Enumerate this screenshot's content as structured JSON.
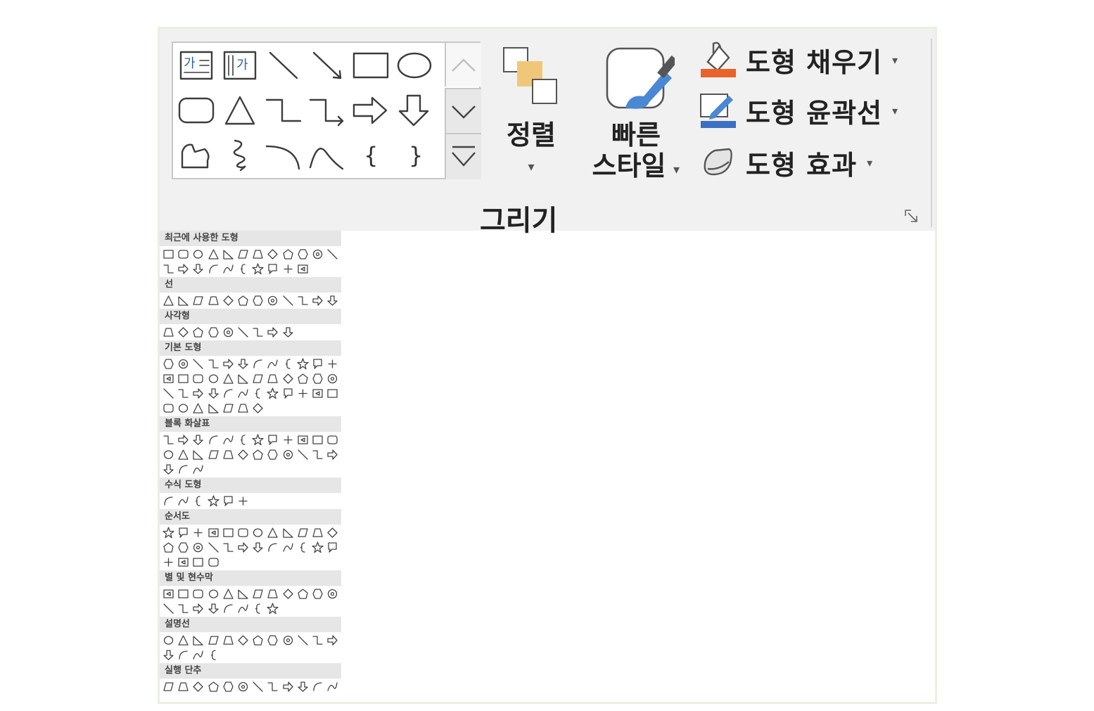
{
  "ribbon": {
    "group_label": "그리기",
    "gallery_shapes": [
      {
        "icon": "horizontal-text-box-icon",
        "text": "가"
      },
      {
        "icon": "vertical-text-box-icon",
        "text": "가"
      },
      {
        "icon": "line-icon"
      },
      {
        "icon": "arrow-line-icon"
      },
      {
        "icon": "rectangle-icon"
      },
      {
        "icon": "oval-icon"
      },
      {
        "icon": "rounded-rectangle-icon"
      },
      {
        "icon": "triangle-icon"
      },
      {
        "icon": "elbow-connector-icon"
      },
      {
        "icon": "elbow-arrow-connector-icon"
      },
      {
        "icon": "right-arrow-icon"
      },
      {
        "icon": "down-arrow-icon"
      },
      {
        "icon": "freeform-shape-icon"
      },
      {
        "icon": "scribble-icon"
      },
      {
        "icon": "arc-icon"
      },
      {
        "icon": "curve-icon"
      },
      {
        "icon": "left-brace-icon",
        "text": "{"
      },
      {
        "icon": "right-brace-icon",
        "text": "}"
      }
    ],
    "arrange_label_1": "정렬",
    "quick_styles_label_1": "빠른",
    "quick_styles_label_2": "스타일",
    "shape_fill_label": "도형 채우기",
    "shape_outline_label": "도형 윤곽선",
    "shape_effects_label": "도형 효과",
    "fill_color": "#e8622a",
    "outline_color": "#3a6fc4",
    "caret": "▾"
  },
  "panel": {
    "sections": [
      {
        "title": "최근에 사용한 도형",
        "count": 22
      },
      {
        "title": "선",
        "count": 12
      },
      {
        "title": "사각형",
        "count": 9
      },
      {
        "title": "기본 도형",
        "count": 43
      },
      {
        "title": "블록 화살표",
        "count": 27
      },
      {
        "title": "수식 도형",
        "count": 6
      },
      {
        "title": "순서도",
        "count": 28
      },
      {
        "title": "별 및 현수막",
        "count": 20
      },
      {
        "title": "설명선",
        "count": 16
      },
      {
        "title": "실행 단추",
        "count": 12
      }
    ]
  }
}
